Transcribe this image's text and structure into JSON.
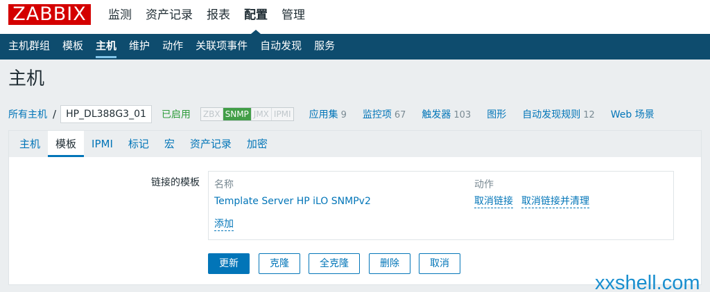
{
  "logo": "ZABBIX",
  "top_menu": [
    {
      "label": "监测",
      "active": false
    },
    {
      "label": "资产记录",
      "active": false
    },
    {
      "label": "报表",
      "active": false
    },
    {
      "label": "配置",
      "active": true
    },
    {
      "label": "管理",
      "active": false
    }
  ],
  "sub_menu": [
    {
      "label": "主机群组",
      "active": false
    },
    {
      "label": "模板",
      "active": false
    },
    {
      "label": "主机",
      "active": true
    },
    {
      "label": "维护",
      "active": false
    },
    {
      "label": "动作",
      "active": false
    },
    {
      "label": "关联项事件",
      "active": false
    },
    {
      "label": "自动发现",
      "active": false
    },
    {
      "label": "服务",
      "active": false
    }
  ],
  "page_title": "主机",
  "host_bar": {
    "all_hosts": "所有主机",
    "separator": "/",
    "current_host": "HP_DL388G3_01",
    "status": "已启用",
    "protocols": [
      "ZBX",
      "SNMP",
      "JMX",
      "IPMI"
    ],
    "active_protocol": "SNMP",
    "links": [
      {
        "label": "应用集",
        "count": "9"
      },
      {
        "label": "监控项",
        "count": "67"
      },
      {
        "label": "触发器",
        "count": "103"
      },
      {
        "label": "图形",
        "count": ""
      },
      {
        "label": "自动发现规则",
        "count": "12"
      },
      {
        "label": "Web 场景",
        "count": ""
      }
    ]
  },
  "tabs": [
    {
      "label": "主机",
      "active": false
    },
    {
      "label": "模板",
      "active": true
    },
    {
      "label": "IPMI",
      "active": false
    },
    {
      "label": "标记",
      "active": false
    },
    {
      "label": "宏",
      "active": false
    },
    {
      "label": "资产记录",
      "active": false
    },
    {
      "label": "加密",
      "active": false
    }
  ],
  "form": {
    "linked_label": "链接的模板",
    "col_name": "名称",
    "col_action": "动作",
    "template_name": "Template Server HP iLO SNMPv2",
    "unlink": "取消链接",
    "unlink_clear": "取消链接并清理",
    "add": "添加"
  },
  "buttons": {
    "update": "更新",
    "clone": "克隆",
    "full_clone": "全克隆",
    "delete": "删除",
    "cancel": "取消"
  },
  "watermark": "xxshell.com",
  "colors": {
    "brand_red": "#d40000",
    "nav_dark": "#0e4c6e",
    "link_blue": "#0275b8",
    "enabled_green": "#2e9c3b",
    "snmp_green": "#429e47"
  }
}
